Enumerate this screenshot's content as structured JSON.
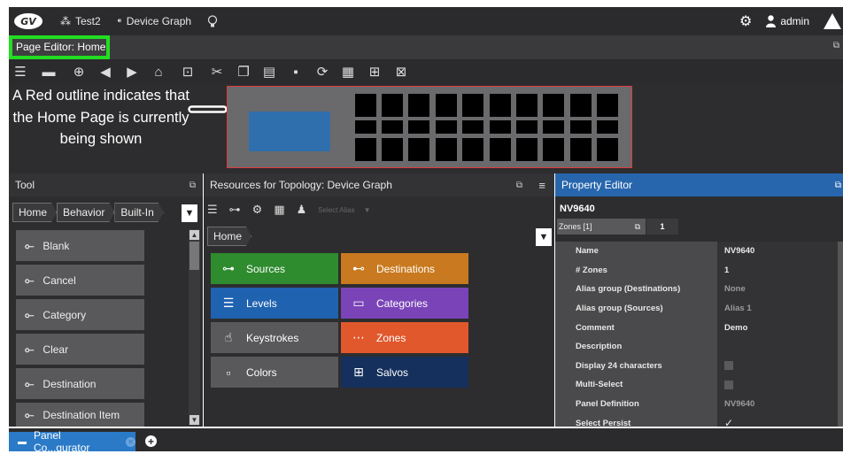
{
  "topbar": {
    "logo_icon": "gv-logo-icon",
    "items": [
      {
        "icon": "network-icon",
        "label": "Test2"
      },
      {
        "icon": "device-graph-icon",
        "label": "Device Graph"
      },
      {
        "icon": "lightbulb-icon",
        "label": ""
      }
    ],
    "settings_icon": "gear-icon",
    "user": "admin",
    "warning_icon": "warning-icon"
  },
  "page_editor": {
    "title": "Page Editor: Home"
  },
  "annotation": {
    "text": "A Red outline indicates that the Home Page is currently being shown"
  },
  "tool_panel": {
    "title": "Tool",
    "breadcrumbs": [
      "Home",
      "Behavior",
      "Built-In"
    ],
    "items": [
      "Blank",
      "Cancel",
      "Category",
      "Clear",
      "Destination",
      "Destination Item"
    ]
  },
  "resources_panel": {
    "title": "Resources for Topology: Device Graph",
    "select_alias_placeholder": "Select Alias",
    "breadcrumb": "Home",
    "tiles": [
      {
        "label": "Sources",
        "color": "#2e8b2e",
        "icon": "sources-icon"
      },
      {
        "label": "Destinations",
        "color": "#c9791f",
        "icon": "destinations-icon"
      },
      {
        "label": "Levels",
        "color": "#1f62b0",
        "icon": "levels-icon"
      },
      {
        "label": "Categories",
        "color": "#7a44b8",
        "icon": "categories-icon"
      },
      {
        "label": "Keystrokes",
        "color": "#59595b",
        "icon": "keystrokes-icon"
      },
      {
        "label": "Zones",
        "color": "#e0582c",
        "icon": "zones-icon"
      },
      {
        "label": "Colors",
        "color": "#59595b",
        "icon": "colors-icon"
      },
      {
        "label": "Salvos",
        "color": "#15305c",
        "icon": "salvos-icon"
      }
    ]
  },
  "property_editor": {
    "title": "Property Editor",
    "object_name": "NV9640",
    "zones_label": "Zones [1]",
    "zones_value": "1",
    "rows": [
      {
        "name": "Name",
        "value": "NV9640",
        "type": "text",
        "dim": false
      },
      {
        "name": "# Zones",
        "value": "1",
        "type": "text",
        "dim": false
      },
      {
        "name": "Alias group (Destinations)",
        "value": "None",
        "type": "text",
        "dim": true
      },
      {
        "name": "Alias group (Sources)",
        "value": "Alias 1",
        "type": "text",
        "dim": true
      },
      {
        "name": "Comment",
        "value": "Demo",
        "type": "text",
        "dim": false
      },
      {
        "name": "Description",
        "value": "",
        "type": "text",
        "dim": false
      },
      {
        "name": "Display 24 characters",
        "value": "",
        "type": "checkbox",
        "dim": false
      },
      {
        "name": "Multi-Select",
        "value": "",
        "type": "checkbox",
        "dim": false
      },
      {
        "name": "Panel Definition",
        "value": "NV9640",
        "type": "text",
        "dim": true
      },
      {
        "name": "Select Persist",
        "value": "✓",
        "type": "text",
        "dim": false
      }
    ]
  },
  "bottom_tab": {
    "label": "Panel Co...gurator"
  }
}
